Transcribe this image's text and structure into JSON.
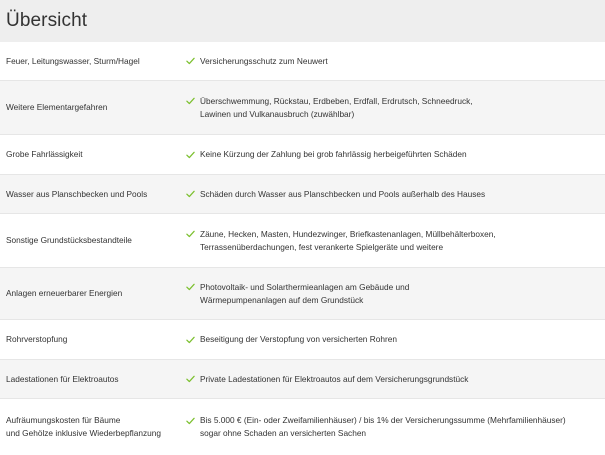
{
  "header": {
    "title": "Übersicht"
  },
  "colors": {
    "check": "#7cc02f",
    "header_bg": "#eeeeee",
    "row_alt_bg": "#f5f5f5",
    "text": "#333333"
  },
  "icons": {
    "check": "check-icon"
  },
  "rows": [
    {
      "label": [
        "Feuer, Leitungswasser, Sturm/Hagel"
      ],
      "value": [
        "Versicherungsschutz zum Neuwert"
      ]
    },
    {
      "label": [
        "Weitere Elementargefahren"
      ],
      "value": [
        "Überschwemmung, Rückstau, Erdbeben, Erdfall, Erdrutsch, Schneedruck,",
        "Lawinen und Vulkanausbruch (zuwählbar)"
      ]
    },
    {
      "label": [
        "Grobe Fahrlässigkeit"
      ],
      "value": [
        "Keine Kürzung der Zahlung bei grob fahrlässig herbeigeführten Schäden"
      ]
    },
    {
      "label": [
        "Wasser aus Planschbecken und Pools"
      ],
      "value": [
        "Schäden durch Wasser aus Planschbecken und Pools außerhalb des Hauses"
      ]
    },
    {
      "label": [
        "Sonstige Grundstücksbestandteile"
      ],
      "value": [
        "Zäune, Hecken, Masten, Hundezwinger, Briefkastenanlagen, Müllbehälterboxen,",
        "Terrassenüberdachungen, fest verankerte Spielgeräte und weitere"
      ]
    },
    {
      "label": [
        "Anlagen erneuerbarer Energien"
      ],
      "value": [
        "Photovoltaik- und Solarthermieanlagen am Gebäude und",
        "Wärmepumpenanlagen auf dem Grundstück"
      ]
    },
    {
      "label": [
        "Rohrverstopfung"
      ],
      "value": [
        "Beseitigung der Verstopfung von versicherten Rohren"
      ]
    },
    {
      "label": [
        "Ladestationen für Elektroautos"
      ],
      "value": [
        "Private Ladestationen für Elektroautos auf dem Versicherungsgrundstück"
      ]
    },
    {
      "label": [
        "Aufräumungskosten für Bäume",
        "und Gehölze inklusive Wiederbepflanzung"
      ],
      "value": [
        "Bis 5.000 € (Ein- oder Zweifamilienhäuser) / bis 1% der Versicherungssumme (Mehrfamilienhäuser)",
        "sogar ohne Schaden an versicherten Sachen"
      ]
    }
  ]
}
